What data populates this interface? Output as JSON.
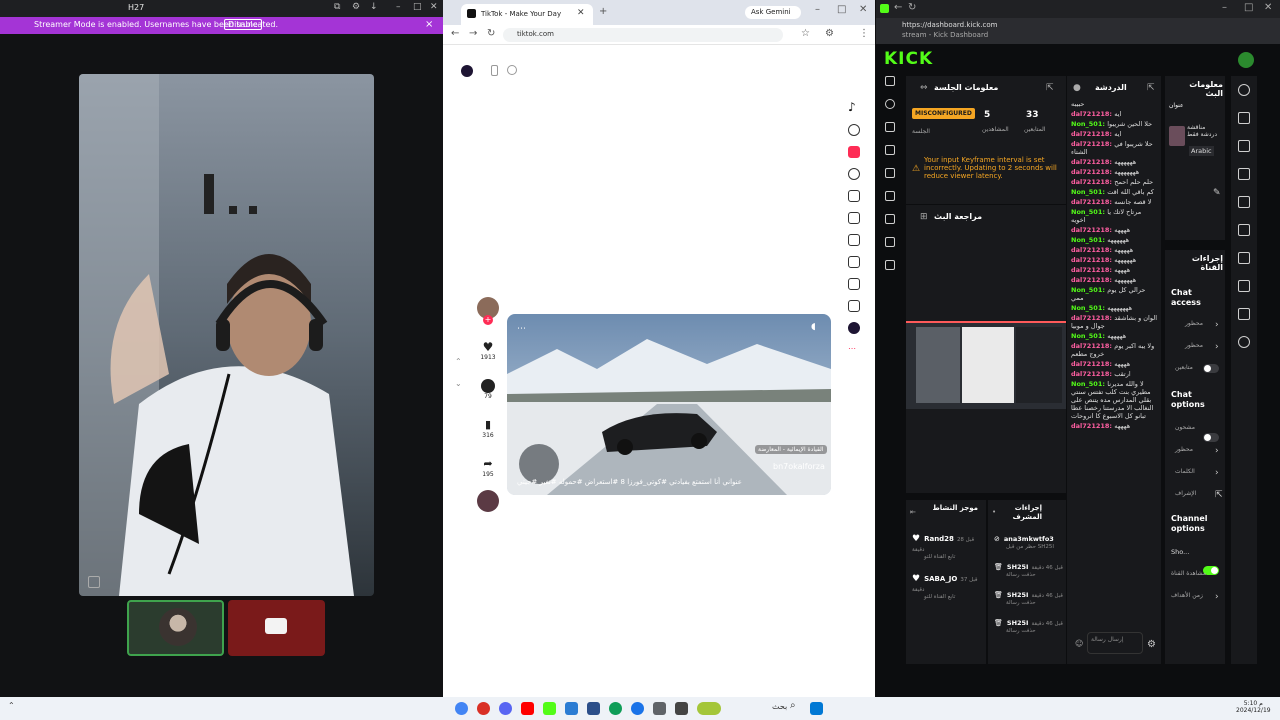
{
  "left_window": {
    "title": "H27",
    "banner_text": "Streamer Mode is enabled. Usernames have been truncated.",
    "banner_action": "Disable",
    "banner_close": "×"
  },
  "tiktok": {
    "tab_title": "TikTok - Make Your Day",
    "new_tab": "+",
    "gemini_label": "Ask Gemini",
    "url": "tiktok.com",
    "video_hashtags": "عنواني أنا استمتع بفيادتي #كوتي_فورزا 8 #استعراض #حموله #تغير #جيتي",
    "video_user": "bn7okalforza",
    "video_game": "القيادة الإيمائية - المعارضة",
    "like_count": "1913",
    "comment_count": "79",
    "save_count": "316",
    "share_count": "195"
  },
  "kick": {
    "url": "https://dashboard.kick.com",
    "page_title": "stream - Kick Dashboard",
    "logo": "KICK",
    "session_title": "معلومات الجلسة",
    "status_badge": "MISCONFIGURED",
    "status_label": "الجلسة",
    "followers_value": "5",
    "followers_label": "المشاهدين",
    "viewers_value": "33",
    "viewers_label": "المتابعين",
    "warning_text": "Your input Keyframe interval is set incorrectly. Updating to 2 seconds will reduce viewer latency.",
    "review_title": "مراجعة البث",
    "chat_title": "الدردشة",
    "chat_messages": [
      {
        "user": "",
        "text": "حبيبه",
        "color": "none"
      },
      {
        "user": "dal721218:",
        "text": "ايه",
        "color": "pink"
      },
      {
        "user": "Non_501:",
        "text": "حلا الحين شريبوا",
        "color": "green"
      },
      {
        "user": "dal721218:",
        "text": "ايه",
        "color": "pink"
      },
      {
        "user": "dal721218:",
        "text": "حلا شريبوا في الشتاء",
        "color": "pink"
      },
      {
        "user": "dal721218:",
        "text": "ههههههه",
        "color": "pink"
      },
      {
        "user": "dal721218:",
        "text": "هههههههه",
        "color": "pink"
      },
      {
        "user": "dal721218:",
        "text": "حلم حلم احمح",
        "color": "pink"
      },
      {
        "user": "Non_501:",
        "text": "كم باقي الله اقت",
        "color": "green"
      },
      {
        "user": "dal721218:",
        "text": "لا قصه جانسه",
        "color": "pink"
      },
      {
        "user": "Non_501:",
        "text": "مرتاح لاتك يا اخويه",
        "color": "green"
      },
      {
        "user": "dal721218:",
        "text": "ههههه",
        "color": "pink"
      },
      {
        "user": "Non_501:",
        "text": "ههههههه",
        "color": "green"
      },
      {
        "user": "dal721218:",
        "text": "هههههه",
        "color": "pink"
      },
      {
        "user": "dal721218:",
        "text": "ههههههه",
        "color": "pink"
      },
      {
        "user": "dal721218:",
        "text": "ههههه",
        "color": "pink"
      },
      {
        "user": "dal721218:",
        "text": "ههههههه",
        "color": "pink"
      },
      {
        "user": "Non_501:",
        "text": "حرالي كل يوم ممي",
        "color": "green"
      },
      {
        "user": "Non_501:",
        "text": "هههههههه",
        "color": "green"
      },
      {
        "user": "dal721218:",
        "text": "الوان و بشاشقد جوال و موبيا",
        "color": "pink"
      },
      {
        "user": "Non_501:",
        "text": "هههههه",
        "color": "green"
      },
      {
        "user": "dal721218:",
        "text": "ولا يبه اكبر يوم خروج مطعم",
        "color": "pink"
      },
      {
        "user": "dal721218:",
        "text": "ههههه",
        "color": "pink"
      },
      {
        "user": "dal721218:",
        "text": "ارتقب",
        "color": "pink"
      },
      {
        "user": "Non_501:",
        "text": "لا والله مديرنا مطيري بنت كلب تفتس سنتي بقلي المدارس مده يتنص على النغالب الا مدرستنا رخصنا عطا تبانو كل الاسبوع كا انروحات",
        "color": "green"
      },
      {
        "user": "dal721218:",
        "text": "ههههه",
        "color": "pink"
      }
    ],
    "chat_input_placeholder": "إرسال رسالة",
    "stream_info_title": "معلومات البث",
    "stream_category": "مناقشة دردشة فقط",
    "language": "Arabic",
    "actions_title": "إجراءات القناة",
    "chat_access_label": "Chat access",
    "access_opt1": "محظور",
    "access_opt2": "محظور",
    "access_opt3": "متابعين",
    "chat_options_label": "Chat options",
    "chat_opt1": "مشحون",
    "chat_opt2": "محظور",
    "chat_opt3": "الكلمات",
    "chat_opt4": "الإشراف",
    "channel_options_label": "Channel options",
    "channel_opt1": "Sho...",
    "channel_opt2": "مشاهدة القناة",
    "channel_opt3": "زمن الأهداف",
    "mods_title": "موجز النشاط",
    "mods": [
      {
        "name": "Rand28",
        "sub": "تابع القناة للتو",
        "time": "قبل 28 دقيقة"
      },
      {
        "name": "SABA_JO",
        "sub": "تابع القناة للتو",
        "time": "قبل 37 دقيقة"
      }
    ],
    "modactions_title": "إجراءات المشرف",
    "modactions": [
      {
        "name": "ana3mkwtfo3",
        "sub": "حظر من قبل SH25I"
      },
      {
        "name": "SH25I",
        "sub": "حذفت رسالة",
        "time": "قبل 46 دقيقة"
      },
      {
        "name": "SH25I",
        "sub": "حذفت رسالة",
        "time": "قبل 46 دقيقة"
      },
      {
        "name": "SH25I",
        "sub": "حذفت رسالة",
        "time": "قبل 46 دقيقة"
      }
    ]
  },
  "taskbar": {
    "search_label": "بحث",
    "clock_time": "5:10 م",
    "clock_date": "2024/12/19"
  },
  "colors": {
    "kick_green": "#53fc18",
    "streamer_banner": "#a434d6",
    "warning_orange": "#f5a623"
  }
}
